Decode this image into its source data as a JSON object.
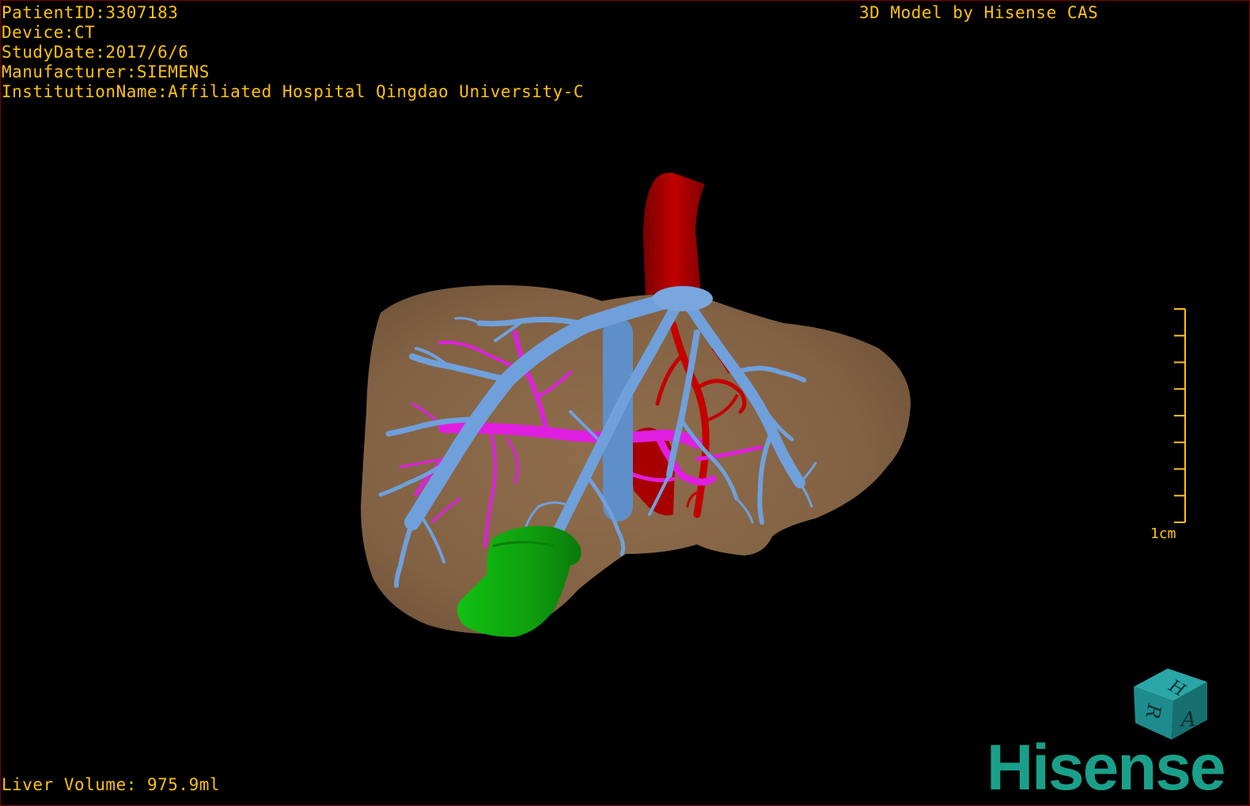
{
  "overlay": {
    "text_color": "#ffc20e",
    "patient_id": "PatientID:3307183",
    "device": "Device:CT",
    "study_date": "StudyDate:2017/6/6",
    "manufacturer": "Manufacturer:SIEMENS",
    "institution": "InstitutionName:Affiliated Hospital Qingdao University-C",
    "credit": "3D Model by Hisense CAS",
    "liver_volume": "Liver Volume: 975.9ml"
  },
  "scale_bar": {
    "label": "1cm",
    "tick_count": 9
  },
  "orientation_cube": {
    "faces": [
      "H",
      "R",
      "A"
    ],
    "color": "#1e8c8c"
  },
  "brand": {
    "logo": "Hisense",
    "color": "#1aa08a"
  },
  "model_colors": {
    "liver": "#8b6a4a",
    "hepatic_vein": "#6fa0dc",
    "portal_vein": "#e01ee0",
    "inferior_vena_cava": "#b00000",
    "hepatic_artery": "#c00000",
    "gallbladder": "#10b010"
  }
}
